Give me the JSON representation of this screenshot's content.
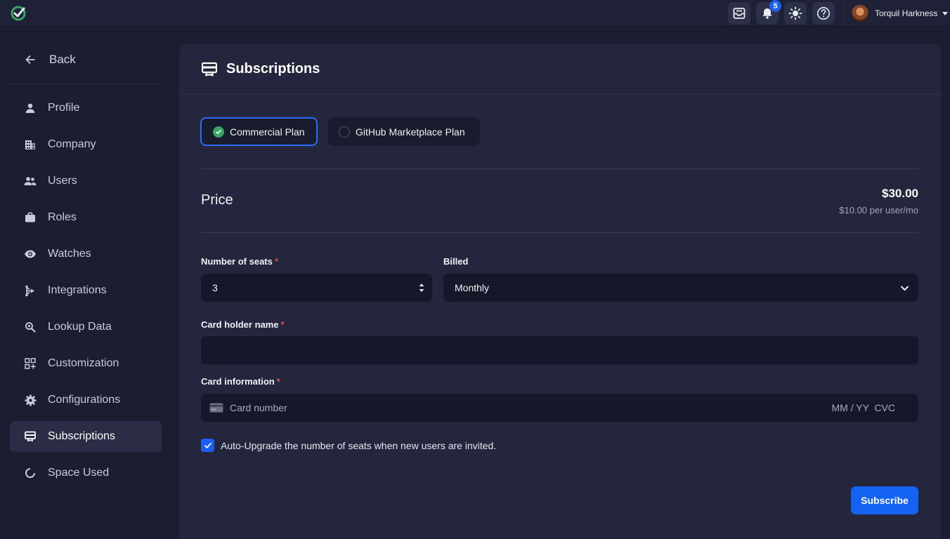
{
  "topbar": {
    "notifications_count": "5",
    "user_name": "Torquil Harkness"
  },
  "sidebar": {
    "back_label": "Back",
    "items": [
      {
        "label": "Profile",
        "icon": "person-icon"
      },
      {
        "label": "Company",
        "icon": "building-icon"
      },
      {
        "label": "Users",
        "icon": "users-icon"
      },
      {
        "label": "Roles",
        "icon": "briefcase-icon"
      },
      {
        "label": "Watches",
        "icon": "eye-icon"
      },
      {
        "label": "Integrations",
        "icon": "integrations-icon"
      },
      {
        "label": "Lookup Data",
        "icon": "magnifier-icon"
      },
      {
        "label": "Customization",
        "icon": "grid-plus-icon"
      },
      {
        "label": "Configurations",
        "icon": "gear-icon"
      },
      {
        "label": "Subscriptions",
        "icon": "subscriptions-icon",
        "active": true
      },
      {
        "label": "Space Used",
        "icon": "pie-icon"
      }
    ]
  },
  "main": {
    "title": "Subscriptions",
    "plans": [
      {
        "label": "Commercial Plan",
        "selected": true
      },
      {
        "label": "GitHub Marketplace Plan",
        "selected": false
      }
    ],
    "price": {
      "label": "Price",
      "total": "$30.00",
      "per_user": "$10.00 per user/mo"
    },
    "form": {
      "seats_label": "Number of seats",
      "seats_value": "3",
      "billed_label": "Billed",
      "billed_value": "Monthly",
      "cardholder_label": "Card holder name",
      "cardholder_value": "",
      "card_info_label": "Card information",
      "card_number_placeholder": "Card number",
      "card_exp_cvc": "MM / YY  CVC",
      "required_mark": "*",
      "auto_upgrade_label": "Auto-Upgrade the number of seats when new users are invited.",
      "auto_upgrade_checked": true
    },
    "subscribe_label": "Subscribe"
  },
  "colors": {
    "accent": "#1c5ef2",
    "success": "#3aa563",
    "required": "#e5484d",
    "background": "#1b1d31",
    "panel": "#23263d"
  }
}
